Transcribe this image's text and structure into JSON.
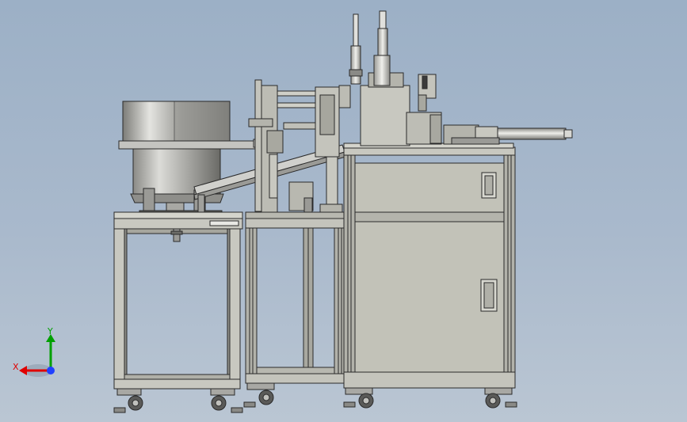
{
  "viewport": {
    "background": "#a9b9cc"
  },
  "machine": {
    "frame_color": "#c8c8c0",
    "cabinet_color": "#c0c0b6",
    "profile_color": "#b2b2aa",
    "line_color": "#2a2a2a",
    "bowl_color": "#b4b4b0",
    "cylinder_color": "#d2d2ce"
  },
  "triad": {
    "x_axis": {
      "label": "X",
      "color": "#e00000"
    },
    "y_axis": {
      "label": "Y",
      "color": "#00a000"
    },
    "z_axis": {
      "color": "#2040ff"
    }
  }
}
